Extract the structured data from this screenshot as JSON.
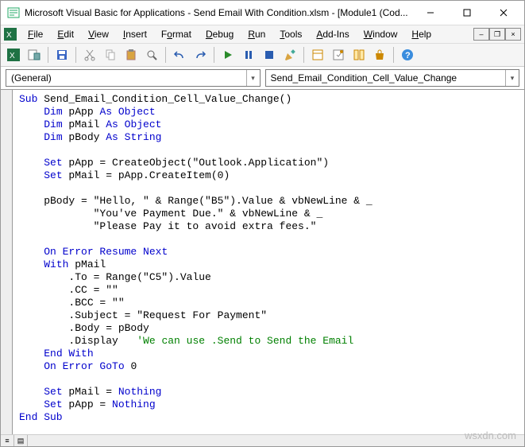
{
  "title": "Microsoft Visual Basic for Applications - Send Email With Condition.xlsm - [Module1 (Cod...",
  "menus": {
    "file": "File",
    "edit": "Edit",
    "view": "View",
    "insert": "Insert",
    "format": "Format",
    "debug": "Debug",
    "run": "Run",
    "tools": "Tools",
    "addins": "Add-Ins",
    "window": "Window",
    "help": "Help"
  },
  "dropdowns": {
    "left": "(General)",
    "right": "Send_Email_Condition_Cell_Value_Change"
  },
  "code": {
    "tokens": [
      {
        "cls": "kw",
        "t": "Sub"
      },
      {
        "t": " Send_Email_Condition_Cell_Value_Change()\n"
      },
      {
        "t": "    "
      },
      {
        "cls": "kw",
        "t": "Dim"
      },
      {
        "t": " pApp "
      },
      {
        "cls": "kw",
        "t": "As Object"
      },
      {
        "t": "\n"
      },
      {
        "t": "    "
      },
      {
        "cls": "kw",
        "t": "Dim"
      },
      {
        "t": " pMail "
      },
      {
        "cls": "kw",
        "t": "As Object"
      },
      {
        "t": "\n"
      },
      {
        "t": "    "
      },
      {
        "cls": "kw",
        "t": "Dim"
      },
      {
        "t": " pBody "
      },
      {
        "cls": "kw",
        "t": "As String"
      },
      {
        "t": "\n"
      },
      {
        "t": "\n"
      },
      {
        "t": "    "
      },
      {
        "cls": "kw",
        "t": "Set"
      },
      {
        "t": " pApp = CreateObject(\"Outlook.Application\")\n"
      },
      {
        "t": "    "
      },
      {
        "cls": "kw",
        "t": "Set"
      },
      {
        "t": " pMail = pApp.CreateItem(0)\n"
      },
      {
        "t": "\n"
      },
      {
        "t": "    pBody = \"Hello, \" & Range(\"B5\").Value & vbNewLine & _\n"
      },
      {
        "t": "            \"You've Payment Due.\" & vbNewLine & _\n"
      },
      {
        "t": "            \"Please Pay it to avoid extra fees.\"\n"
      },
      {
        "t": "\n"
      },
      {
        "t": "    "
      },
      {
        "cls": "kw",
        "t": "On Error Resume Next"
      },
      {
        "t": "\n"
      },
      {
        "t": "    "
      },
      {
        "cls": "kw",
        "t": "With"
      },
      {
        "t": " pMail\n"
      },
      {
        "t": "        .To = Range(\"C5\").Value\n"
      },
      {
        "t": "        .CC = \"\"\n"
      },
      {
        "t": "        .BCC = \"\"\n"
      },
      {
        "t": "        .Subject = \"Request For Payment\"\n"
      },
      {
        "t": "        .Body = pBody\n"
      },
      {
        "t": "        .Display   "
      },
      {
        "cls": "cmt",
        "t": "'We can use .Send to Send the Email"
      },
      {
        "t": "\n"
      },
      {
        "t": "    "
      },
      {
        "cls": "kw",
        "t": "End With"
      },
      {
        "t": "\n"
      },
      {
        "t": "    "
      },
      {
        "cls": "kw",
        "t": "On Error GoTo"
      },
      {
        "t": " 0\n"
      },
      {
        "t": "\n"
      },
      {
        "t": "    "
      },
      {
        "cls": "kw",
        "t": "Set"
      },
      {
        "t": " pMail = "
      },
      {
        "cls": "kw",
        "t": "Nothing"
      },
      {
        "t": "\n"
      },
      {
        "t": "    "
      },
      {
        "cls": "kw",
        "t": "Set"
      },
      {
        "t": " pApp = "
      },
      {
        "cls": "kw",
        "t": "Nothing"
      },
      {
        "t": "\n"
      },
      {
        "cls": "kw",
        "t": "End Sub"
      },
      {
        "t": "\n"
      }
    ]
  },
  "watermark": "wsxdn.com"
}
